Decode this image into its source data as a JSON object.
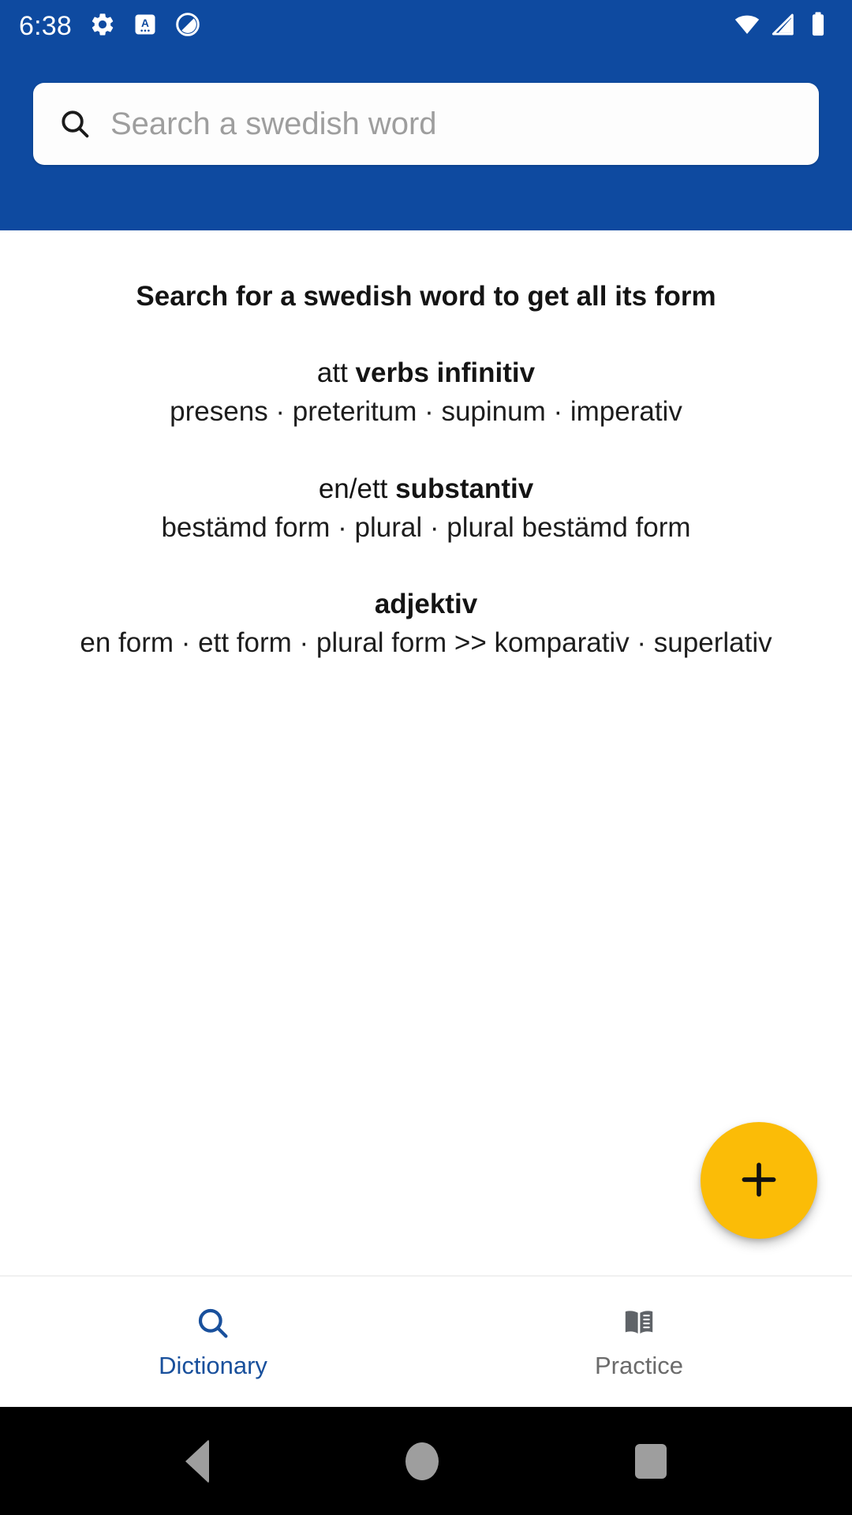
{
  "statusbar": {
    "clock": "6:38",
    "left_icons": [
      "gear-icon",
      "a-badge-icon",
      "circle-slash-icon"
    ],
    "right_icons": [
      "wifi-icon",
      "cellular-signal-icon",
      "battery-icon"
    ]
  },
  "search": {
    "placeholder": "Search a swedish word",
    "value": "",
    "icon": "search-icon"
  },
  "content": {
    "intro_title": "Search for a swedish word to get all its form",
    "groups": [
      {
        "lead": "att ",
        "key": "verbs infinitiv",
        "forms": "presens · preteritum · supinum · imperativ"
      },
      {
        "lead": "en/ett ",
        "key": "substantiv",
        "forms": "bestämd form · plural · plural bestämd form"
      },
      {
        "lead": "",
        "key": "adjektiv",
        "forms": "en form · ett form · plural form >> komparativ · superlativ"
      }
    ]
  },
  "fab": {
    "icon": "plus-icon",
    "label": "",
    "color": "#FBBC07"
  },
  "bottom_nav": {
    "items": [
      {
        "label": "Dictionary",
        "icon": "search-icon",
        "active": true
      },
      {
        "label": "Practice",
        "icon": "book-icon",
        "active": false
      }
    ],
    "active_color": "#19509C",
    "inactive_color": "#6b6b6b"
  },
  "system_nav": {
    "back": "back-triangle-icon",
    "home": "home-circle-icon",
    "recents": "recents-square-icon"
  },
  "theme": {
    "primary": "#0E4AA0",
    "accent": "#FBBC07",
    "background": "#ffffff"
  }
}
